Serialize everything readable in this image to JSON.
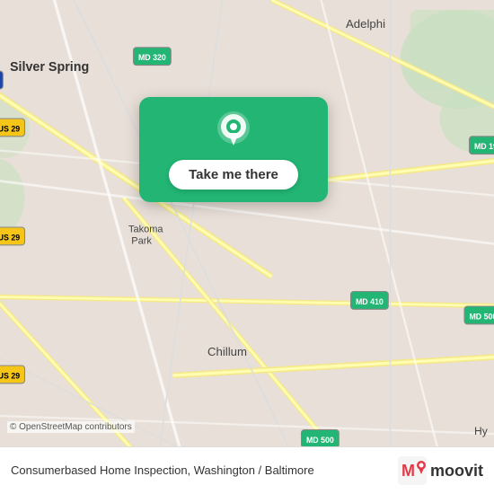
{
  "map": {
    "bg_color": "#e8e0d8",
    "osm_credit": "© OpenStreetMap contributors"
  },
  "popup": {
    "button_label": "Take me there",
    "pin_icon": "location-pin"
  },
  "bottom_bar": {
    "title": "Consumerbased Home Inspection, Washington / Baltimore",
    "brand": "moovit"
  }
}
